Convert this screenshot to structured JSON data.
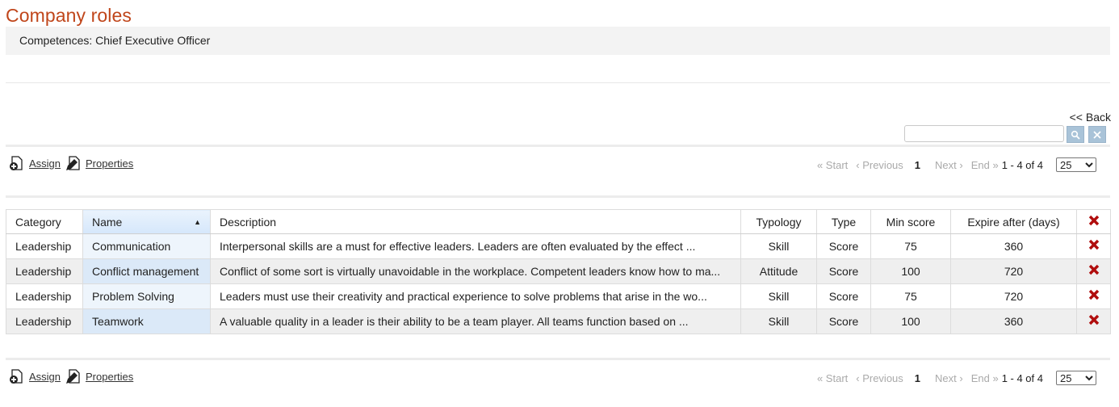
{
  "page": {
    "title": "Company roles",
    "subtitle": "Competences: Chief Executive Officer",
    "back_label": "<< Back"
  },
  "search": {
    "value": "",
    "placeholder": ""
  },
  "toolbar": {
    "assign_label": "Assign",
    "properties_label": "Properties"
  },
  "pager": {
    "start": "« Start",
    "previous": "‹ Previous",
    "current": "1",
    "next": "Next ›",
    "end": "End »",
    "count": "1 - 4 of 4",
    "page_size": "25"
  },
  "table": {
    "columns": [
      "Category",
      "Name",
      "Description",
      "Typology",
      "Type",
      "Min score",
      "Expire after (days)"
    ],
    "sorted_column": "Name",
    "rows": [
      {
        "category": "Leadership",
        "name": "Communication",
        "description": "Interpersonal skills are a must for effective leaders. Leaders are often evaluated by the effect ...",
        "typology": "Skill",
        "type": "Score",
        "min_score": "75",
        "expire": "360"
      },
      {
        "category": "Leadership",
        "name": "Conflict management",
        "description": "Conflict of some sort is virtually unavoidable in the workplace. Competent leaders know how to ma...",
        "typology": "Attitude",
        "type": "Score",
        "min_score": "100",
        "expire": "720"
      },
      {
        "category": "Leadership",
        "name": "Problem Solving",
        "description": "Leaders must use their creativity and practical experience to solve problems that arise in the wo...",
        "typology": "Skill",
        "type": "Score",
        "min_score": "75",
        "expire": "720"
      },
      {
        "category": "Leadership",
        "name": "Teamwork",
        "description": "A valuable quality in a leader is their ability to be a team player. All teams function based on ...",
        "typology": "Skill",
        "type": "Score",
        "min_score": "100",
        "expire": "360"
      }
    ]
  },
  "colors": {
    "title": "#c0461b",
    "delete": "#b00d0d",
    "sorted_header": "#d5e7fb"
  },
  "icons": {
    "assign": "page-add-icon",
    "properties": "page-edit-icon",
    "delete": "delete-x-icon",
    "search": "search-icon",
    "clear": "clear-x-icon"
  }
}
